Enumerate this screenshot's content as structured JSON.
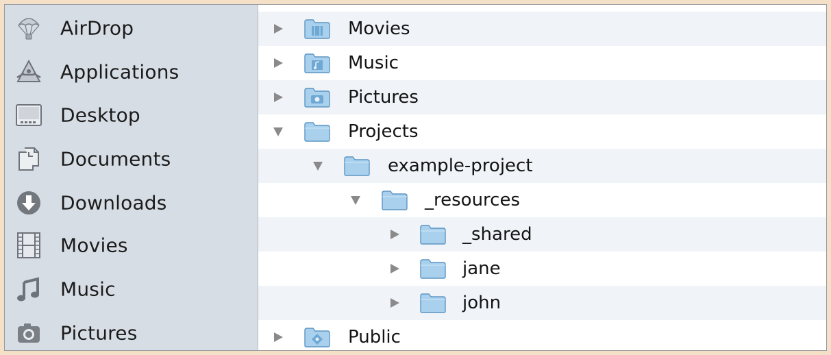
{
  "sidebar": {
    "items": [
      {
        "label": "AirDrop",
        "icon": "airdrop-icon"
      },
      {
        "label": "Applications",
        "icon": "applications-icon"
      },
      {
        "label": "Desktop",
        "icon": "desktop-icon"
      },
      {
        "label": "Documents",
        "icon": "documents-icon"
      },
      {
        "label": "Downloads",
        "icon": "downloads-icon"
      },
      {
        "label": "Movies",
        "icon": "movies-icon"
      },
      {
        "label": "Music",
        "icon": "music-icon"
      },
      {
        "label": "Pictures",
        "icon": "pictures-icon"
      }
    ]
  },
  "outline": {
    "rows": [
      {
        "label": "Movies",
        "expanded": false,
        "depth": 0,
        "folder_badge": "film"
      },
      {
        "label": "Music",
        "expanded": false,
        "depth": 0,
        "folder_badge": "note"
      },
      {
        "label": "Pictures",
        "expanded": false,
        "depth": 0,
        "folder_badge": "camera"
      },
      {
        "label": "Projects",
        "expanded": true,
        "depth": 0,
        "folder_badge": "none"
      },
      {
        "label": "example-project",
        "expanded": true,
        "depth": 1,
        "folder_badge": "none"
      },
      {
        "label": "_resources",
        "expanded": true,
        "depth": 2,
        "folder_badge": "none"
      },
      {
        "label": "_shared",
        "expanded": false,
        "depth": 3,
        "folder_badge": "none"
      },
      {
        "label": "jane",
        "expanded": false,
        "depth": 3,
        "folder_badge": "none"
      },
      {
        "label": "john",
        "expanded": false,
        "depth": 3,
        "folder_badge": "none"
      },
      {
        "label": "Public",
        "expanded": false,
        "depth": 0,
        "folder_badge": "public"
      }
    ]
  },
  "colors": {
    "sidebar_bg": "#d7dde5",
    "row_alt_bg": "#f0f4f8",
    "folder_blue": "#a9d1ee",
    "disclosure_gray": "#8a8a8a"
  }
}
